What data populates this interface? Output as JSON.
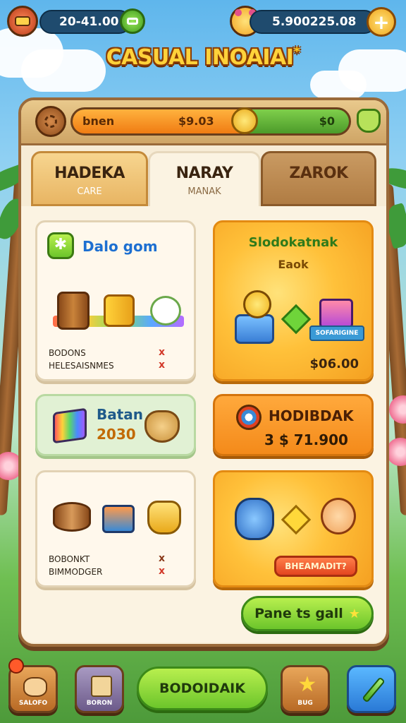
{
  "top_bar": {
    "left_value": "20-41.00",
    "right_value_1": "5.900",
    "right_value_2": "225.08"
  },
  "title": {
    "main": "CASUAL INOAIAI",
    "star": "*"
  },
  "panel": {
    "progress": {
      "left_label": "bnen",
      "center_value": "$9.03",
      "right_value": "$0"
    },
    "tabs": [
      {
        "label": "HADEKA",
        "sub": "CARE"
      },
      {
        "label": "NARAY",
        "sub": "MANAK"
      },
      {
        "label": "ZAROK",
        "sub": ""
      }
    ],
    "cards": {
      "card1": {
        "title": "Dalo gom",
        "line1": "BODONS",
        "line2": "HELESAISNMES",
        "mark1": "x",
        "mark2": "x"
      },
      "card2": {
        "title_line1": "Slodokatnak",
        "title_line2": "Eaok",
        "ribbon": "SOFARIGINE",
        "price": "$06.00"
      },
      "card3": {
        "line1": "Batan",
        "line2": "2030"
      },
      "card4": {
        "title": "HODIBDAK",
        "value": "3 $ 71.900"
      },
      "card5": {
        "line1": "BOBONKT",
        "line2": "BIMMODGER",
        "mark1": "x",
        "mark2": "x"
      },
      "card6": {
        "button": "BHEAMADIT?"
      }
    },
    "action_button": "Pane ts gall"
  },
  "bottom_nav": {
    "btn1": "SALOFO",
    "btn2": "BORON",
    "center": "BODOIDAIK",
    "btn4": "BUG"
  },
  "colors": {
    "accent_green": "#6cc52b",
    "accent_orange": "#f5a021",
    "title_yellow": "#ffd23a",
    "sky_blue": "#5fb6ec"
  }
}
